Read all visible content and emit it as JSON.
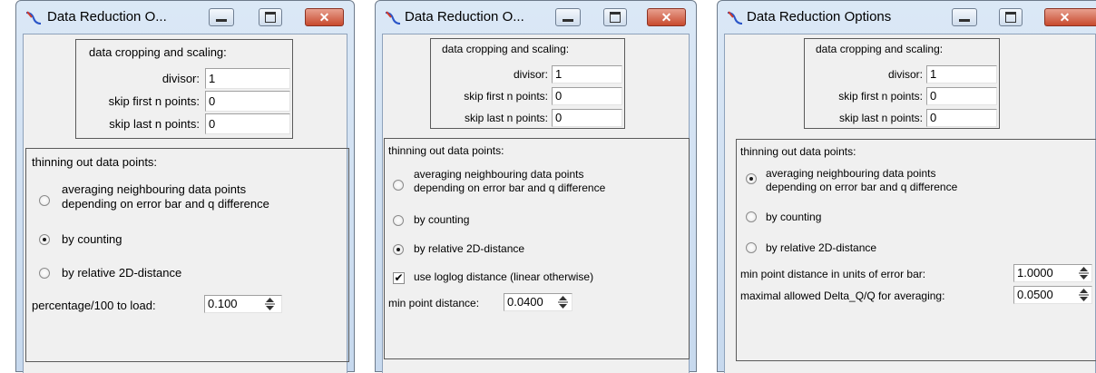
{
  "windows": [
    {
      "title": "Data Reduction O...",
      "cropping": {
        "heading": "data cropping and scaling:",
        "divisor_label": "divisor:",
        "divisor_value": "1",
        "skip_first_label": "skip first n points:",
        "skip_first_value": "0",
        "skip_last_label": "skip last n points:",
        "skip_last_value": "0"
      },
      "thinning": {
        "heading": "thinning out data points:",
        "option_averaging_line1": "averaging neighbouring data points",
        "option_averaging_line2": "depending on error bar and q difference",
        "option_counting": "by counting",
        "option_distance": "by relative 2D-distance",
        "selected": "counting",
        "param_label": "percentage/100 to load:",
        "param_value": "0.100"
      }
    },
    {
      "title": "Data Reduction O...",
      "cropping": {
        "heading": "data cropping and scaling:",
        "divisor_label": "divisor:",
        "divisor_value": "1",
        "skip_first_label": "skip first n points:",
        "skip_first_value": "0",
        "skip_last_label": "skip last n points:",
        "skip_last_value": "0"
      },
      "thinning": {
        "heading": "thinning out data points:",
        "option_averaging_line1": "averaging neighbouring data points",
        "option_averaging_line2": "depending on error bar and q difference",
        "option_counting": "by counting",
        "option_distance": "by relative 2D-distance",
        "selected": "distance",
        "loglog_label": "use loglog distance (linear otherwise)",
        "loglog_checked": true,
        "param_label": "min point distance:",
        "param_value": "0.0400"
      }
    },
    {
      "title": "Data Reduction Options",
      "cropping": {
        "heading": "data cropping and scaling:",
        "divisor_label": "divisor:",
        "divisor_value": "1",
        "skip_first_label": "skip first n points:",
        "skip_first_value": "0",
        "skip_last_label": "skip last n points:",
        "skip_last_value": "0"
      },
      "thinning": {
        "heading": "thinning out data points:",
        "option_averaging_line1": "averaging neighbouring data points",
        "option_averaging_line2": "depending on error bar and q difference",
        "option_counting": "by counting",
        "option_distance": "by relative 2D-distance",
        "selected": "averaging",
        "param1_label": "min point distance in units of error bar:",
        "param1_value": "1.0000",
        "param2_label": "maximal allowed Delta_Q/Q for averaging:",
        "param2_value": "0.0500"
      }
    }
  ],
  "icons": {
    "app": "plot-icon",
    "minimize": "minimize-icon",
    "maximize": "maximize-icon",
    "close": "close-icon",
    "spin_up": "spin-up-icon",
    "spin_down": "spin-down-icon"
  }
}
